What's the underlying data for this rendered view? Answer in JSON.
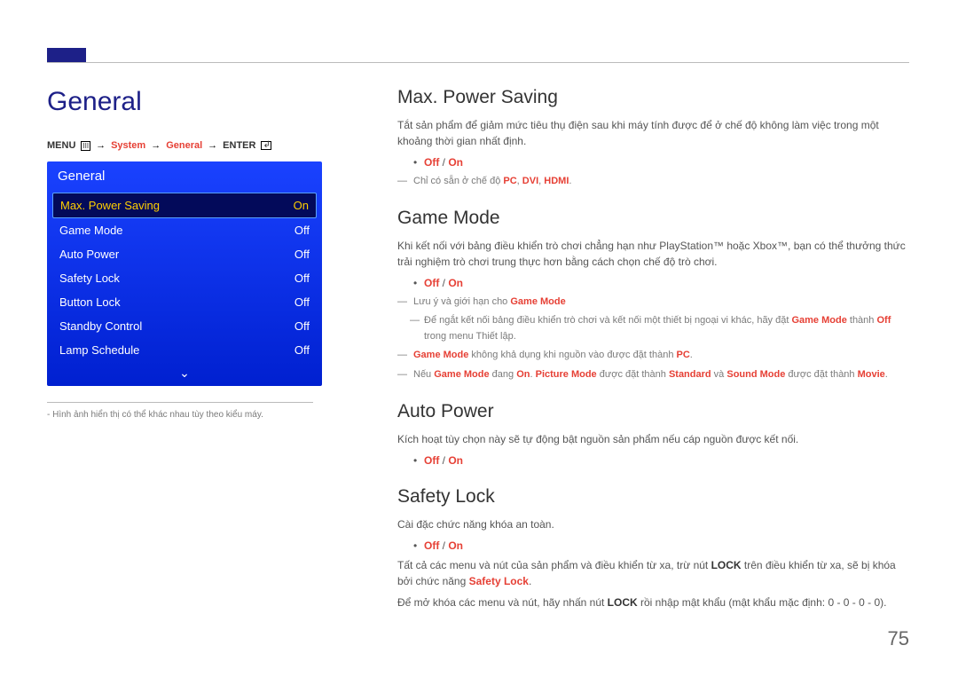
{
  "left": {
    "title": "General",
    "breadcrumb": {
      "menu": "MENU",
      "system": "System",
      "general": "General",
      "enter": "ENTER"
    },
    "osd": {
      "title": "General",
      "items": [
        {
          "label": "Max. Power Saving",
          "value": "On",
          "selected": true
        },
        {
          "label": "Game Mode",
          "value": "Off",
          "selected": false
        },
        {
          "label": "Auto Power",
          "value": "Off",
          "selected": false
        },
        {
          "label": "Safety Lock",
          "value": "Off",
          "selected": false
        },
        {
          "label": "Button Lock",
          "value": "Off",
          "selected": false
        },
        {
          "label": "Standby Control",
          "value": "Off",
          "selected": false
        },
        {
          "label": "Lamp Schedule",
          "value": "Off",
          "selected": false
        }
      ],
      "more_indicator": "⌄"
    },
    "footnote_prefix": "- ",
    "footnote": "Hình ảnh hiển thị có thể khác nhau tùy theo kiểu máy."
  },
  "right": {
    "s1": {
      "title": "Max. Power Saving",
      "p1": "Tắt sản phẩm để giảm mức tiêu thụ điện sau khi máy tính được để ở chế độ không làm việc trong một khoảng thời gian nhất định.",
      "offon_off": "Off",
      "offon_slash": " / ",
      "offon_on": "On",
      "note_prefix": "Chỉ có sẵn ở chế độ ",
      "note_modes": "PC",
      "note_sep1": ", ",
      "note_dvi": "DVI",
      "note_sep2": ", ",
      "note_hdmi": "HDMI",
      "note_suffix": "."
    },
    "s2": {
      "title": "Game Mode",
      "p1": "Khi kết nối với bảng điều khiển trò chơi chẳng hạn như PlayStation™ hoặc Xbox™, bạn có thể thưởng thức trải nghiệm trò chơi trung thực hơn bằng cách chọn chế độ trò chơi.",
      "offon_off": "Off",
      "offon_slash": " / ",
      "offon_on": "On",
      "d1_prefix": "Lưu ý và giới hạn cho ",
      "d1_red": "Game Mode",
      "d1a_prefix": "Để ngắt kết nối bảng điều khiển trò chơi và kết nối một thiết bị ngoại vi khác, hãy đặt ",
      "d1a_gm": "Game Mode",
      "d1a_mid": " thành ",
      "d1a_off": "Off",
      "d1a_suffix": " trong menu Thiết lập.",
      "d2_gm": "Game Mode",
      "d2_mid": " không khả dụng khi nguồn vào được đặt thành ",
      "d2_pc": "PC",
      "d2_suffix": ".",
      "d3_prefix": "Nếu ",
      "d3_gm": "Game Mode",
      "d3_dang": " đang ",
      "d3_on": "On",
      "d3_sep1": ". ",
      "d3_pm": "Picture Mode",
      "d3_set1": " được đặt thành ",
      "d3_std": "Standard",
      "d3_and": " và ",
      "d3_sm": "Sound Mode",
      "d3_set2": " được đặt thành ",
      "d3_movie": "Movie",
      "d3_suffix": "."
    },
    "s3": {
      "title": "Auto Power",
      "p1": "Kích hoạt tùy chọn này sẽ tự động bật nguồn sản phẩm nếu cáp nguồn được kết nối.",
      "offon_off": "Off",
      "offon_slash": " / ",
      "offon_on": "On"
    },
    "s4": {
      "title": "Safety Lock",
      "p1": "Cài đặc chức năng khóa an toàn.",
      "offon_off": "Off",
      "offon_slash": " / ",
      "offon_on": "On",
      "p2_a": "Tất cả các menu và nút của sản phẩm và điều khiển từ xa, trừ nút ",
      "p2_lock": "LOCK",
      "p2_b": " trên điều khiển từ xa, sẽ bị khóa bởi chức năng ",
      "p2_sl": "Safety Lock",
      "p2_c": ".",
      "p3_a": "Để mở khóa các menu và nút, hãy nhấn nút ",
      "p3_lock": "LOCK",
      "p3_b": " rồi nhập mật khẩu (mật khẩu mặc định: 0 - 0 - 0 - 0)."
    }
  },
  "page_number": "75"
}
